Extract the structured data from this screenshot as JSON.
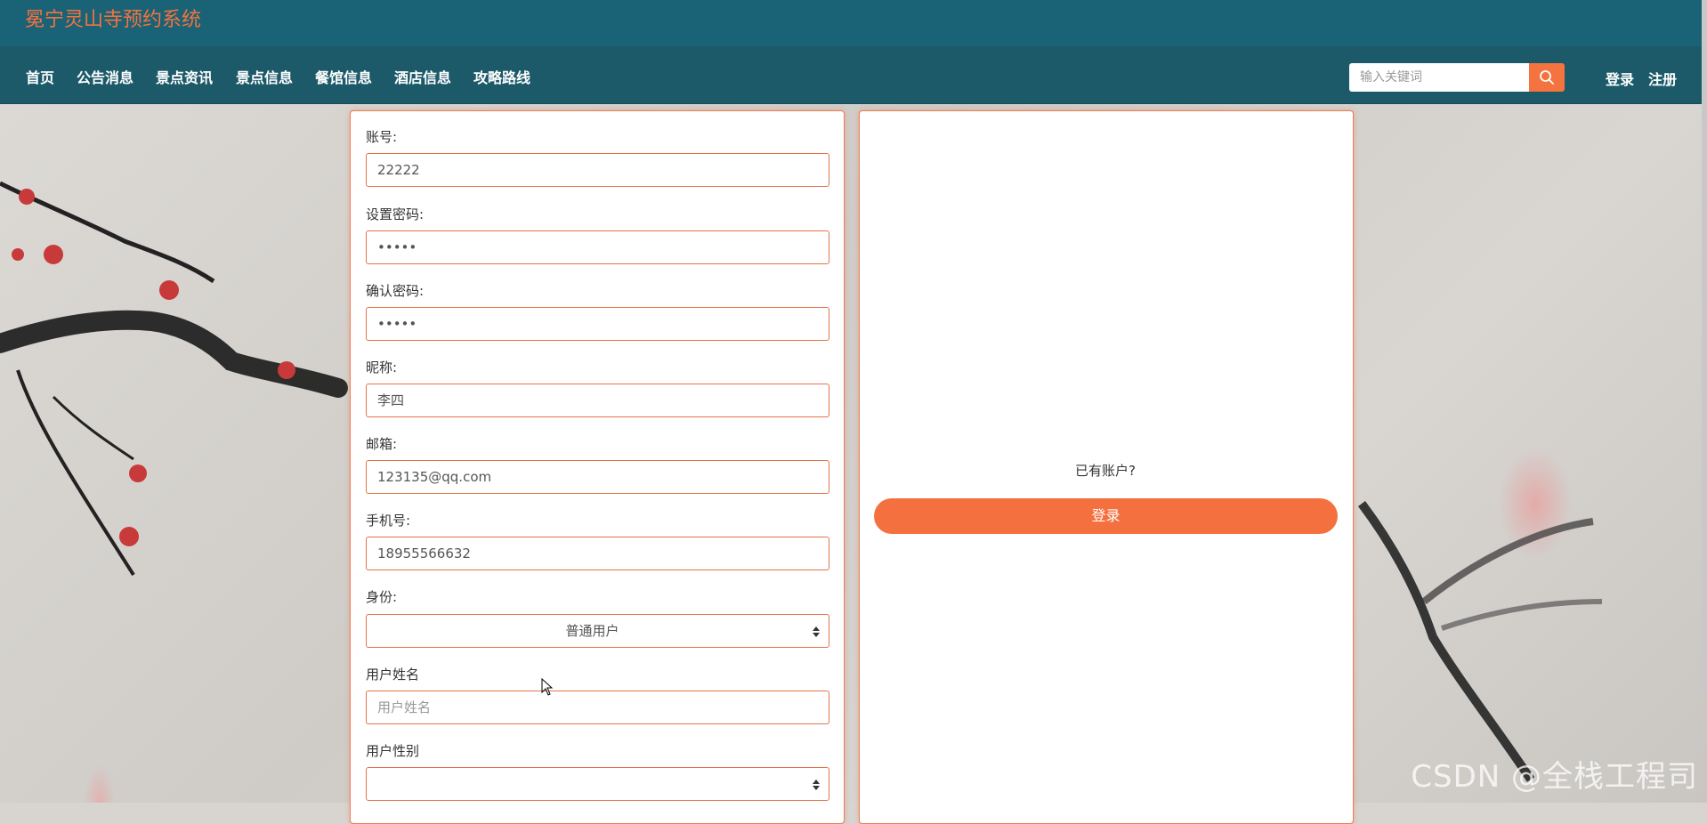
{
  "site": {
    "title": "冕宁灵山寺预约系统"
  },
  "nav": {
    "items": [
      "首页",
      "公告消息",
      "景点资讯",
      "景点信息",
      "餐馆信息",
      "酒店信息",
      "攻略路线"
    ],
    "search_placeholder": "输入关键词",
    "login": "登录",
    "register": "注册"
  },
  "form": {
    "account": {
      "label": "账号:",
      "value": "22222"
    },
    "password": {
      "label": "设置密码:",
      "value": "•••••"
    },
    "confirm_password": {
      "label": "确认密码:",
      "value": "•••••"
    },
    "nickname": {
      "label": "昵称:",
      "value": "李四"
    },
    "email": {
      "label": "邮箱:",
      "value": "123135@qq.com"
    },
    "phone": {
      "label": "手机号:",
      "value": "18955566632"
    },
    "role": {
      "label": "身份:",
      "value": "普通用户"
    },
    "user_name": {
      "label": "用户姓名",
      "placeholder": "用户姓名"
    },
    "user_gender": {
      "label": "用户性别",
      "value": ""
    }
  },
  "right_panel": {
    "has_account": "已有账户?",
    "login_button": "登录"
  },
  "watermark": "CSDN @全栈工程司",
  "colors": {
    "header": "#1a6275",
    "nav": "#1c5a6a",
    "accent": "#f4733f"
  }
}
